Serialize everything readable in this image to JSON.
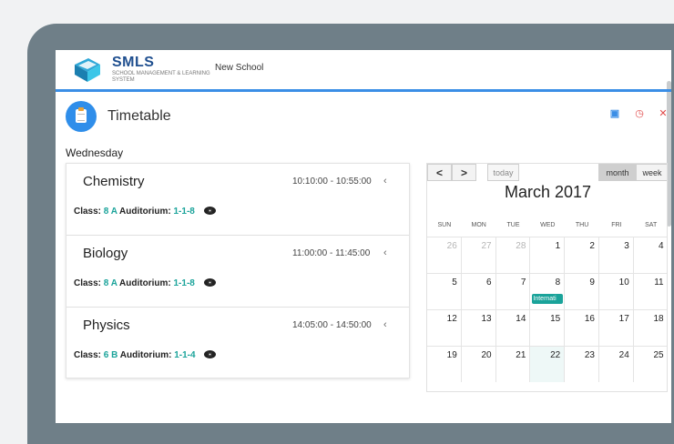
{
  "header": {
    "logo_title": "SMLS",
    "logo_subtitle": "SCHOOL MANAGEMENT & LEARNING SYSTEM",
    "school_name": "New School"
  },
  "page": {
    "title": "Timetable",
    "day": "Wednesday",
    "actions": [
      "calendar-icon",
      "clock-icon",
      "close-icon"
    ]
  },
  "lessons": [
    {
      "name": "Chemistry",
      "time": "10:10:00 - 10:55:00",
      "class_label": "Class:",
      "class_value": "8 A",
      "auditorium_label": "Auditorium:",
      "auditorium_value": "1-1-8"
    },
    {
      "name": "Biology",
      "time": "11:00:00 - 11:45:00",
      "class_label": "Class:",
      "class_value": "8 A",
      "auditorium_label": "Auditorium:",
      "auditorium_value": "1-1-8"
    },
    {
      "name": "Physics",
      "time": "14:05:00 - 14:50:00",
      "class_label": "Class:",
      "class_value": "6 B",
      "auditorium_label": "Auditorium:",
      "auditorium_value": "1-1-4"
    }
  ],
  "calendar": {
    "prev_label": "<",
    "next_label": ">",
    "today_label": "today",
    "month_label": "month",
    "week_label": "week",
    "title": "March 2017",
    "weekdays": [
      "SUN",
      "MON",
      "TUE",
      "WED",
      "THU",
      "FRI",
      "SAT"
    ],
    "weeks": [
      [
        "26",
        "27",
        "28",
        "1",
        "2",
        "3",
        "4"
      ],
      [
        "5",
        "6",
        "7",
        "8",
        "9",
        "10",
        "11"
      ],
      [
        "12",
        "13",
        "14",
        "15",
        "16",
        "17",
        "18"
      ],
      [
        "19",
        "20",
        "21",
        "22",
        "23",
        "24",
        "25"
      ]
    ],
    "event": {
      "label": "Internati",
      "day": "8"
    },
    "today": "22",
    "accent": "#1aa39a"
  },
  "colors": {
    "primary": "#2f8eea",
    "teal": "#1aa39a",
    "danger": "#e04848",
    "frame": "#6f7f88"
  }
}
